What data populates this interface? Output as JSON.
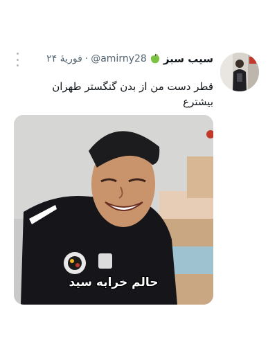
{
  "tweet": {
    "author_name": "سیب سبز",
    "author_emoji_icon": "green-apple-icon",
    "handle": "@amirny28",
    "separator": "·",
    "time": "۲۴ فوریهٔ",
    "text": "قطر دست من از بدن گنگستر طهران بیشترع",
    "media_caption": "حالم خرابه سید",
    "colors": {
      "name": "#0f1419",
      "secondary": "#536471",
      "apple": "#7cc242",
      "caption": "#ffffff"
    }
  }
}
